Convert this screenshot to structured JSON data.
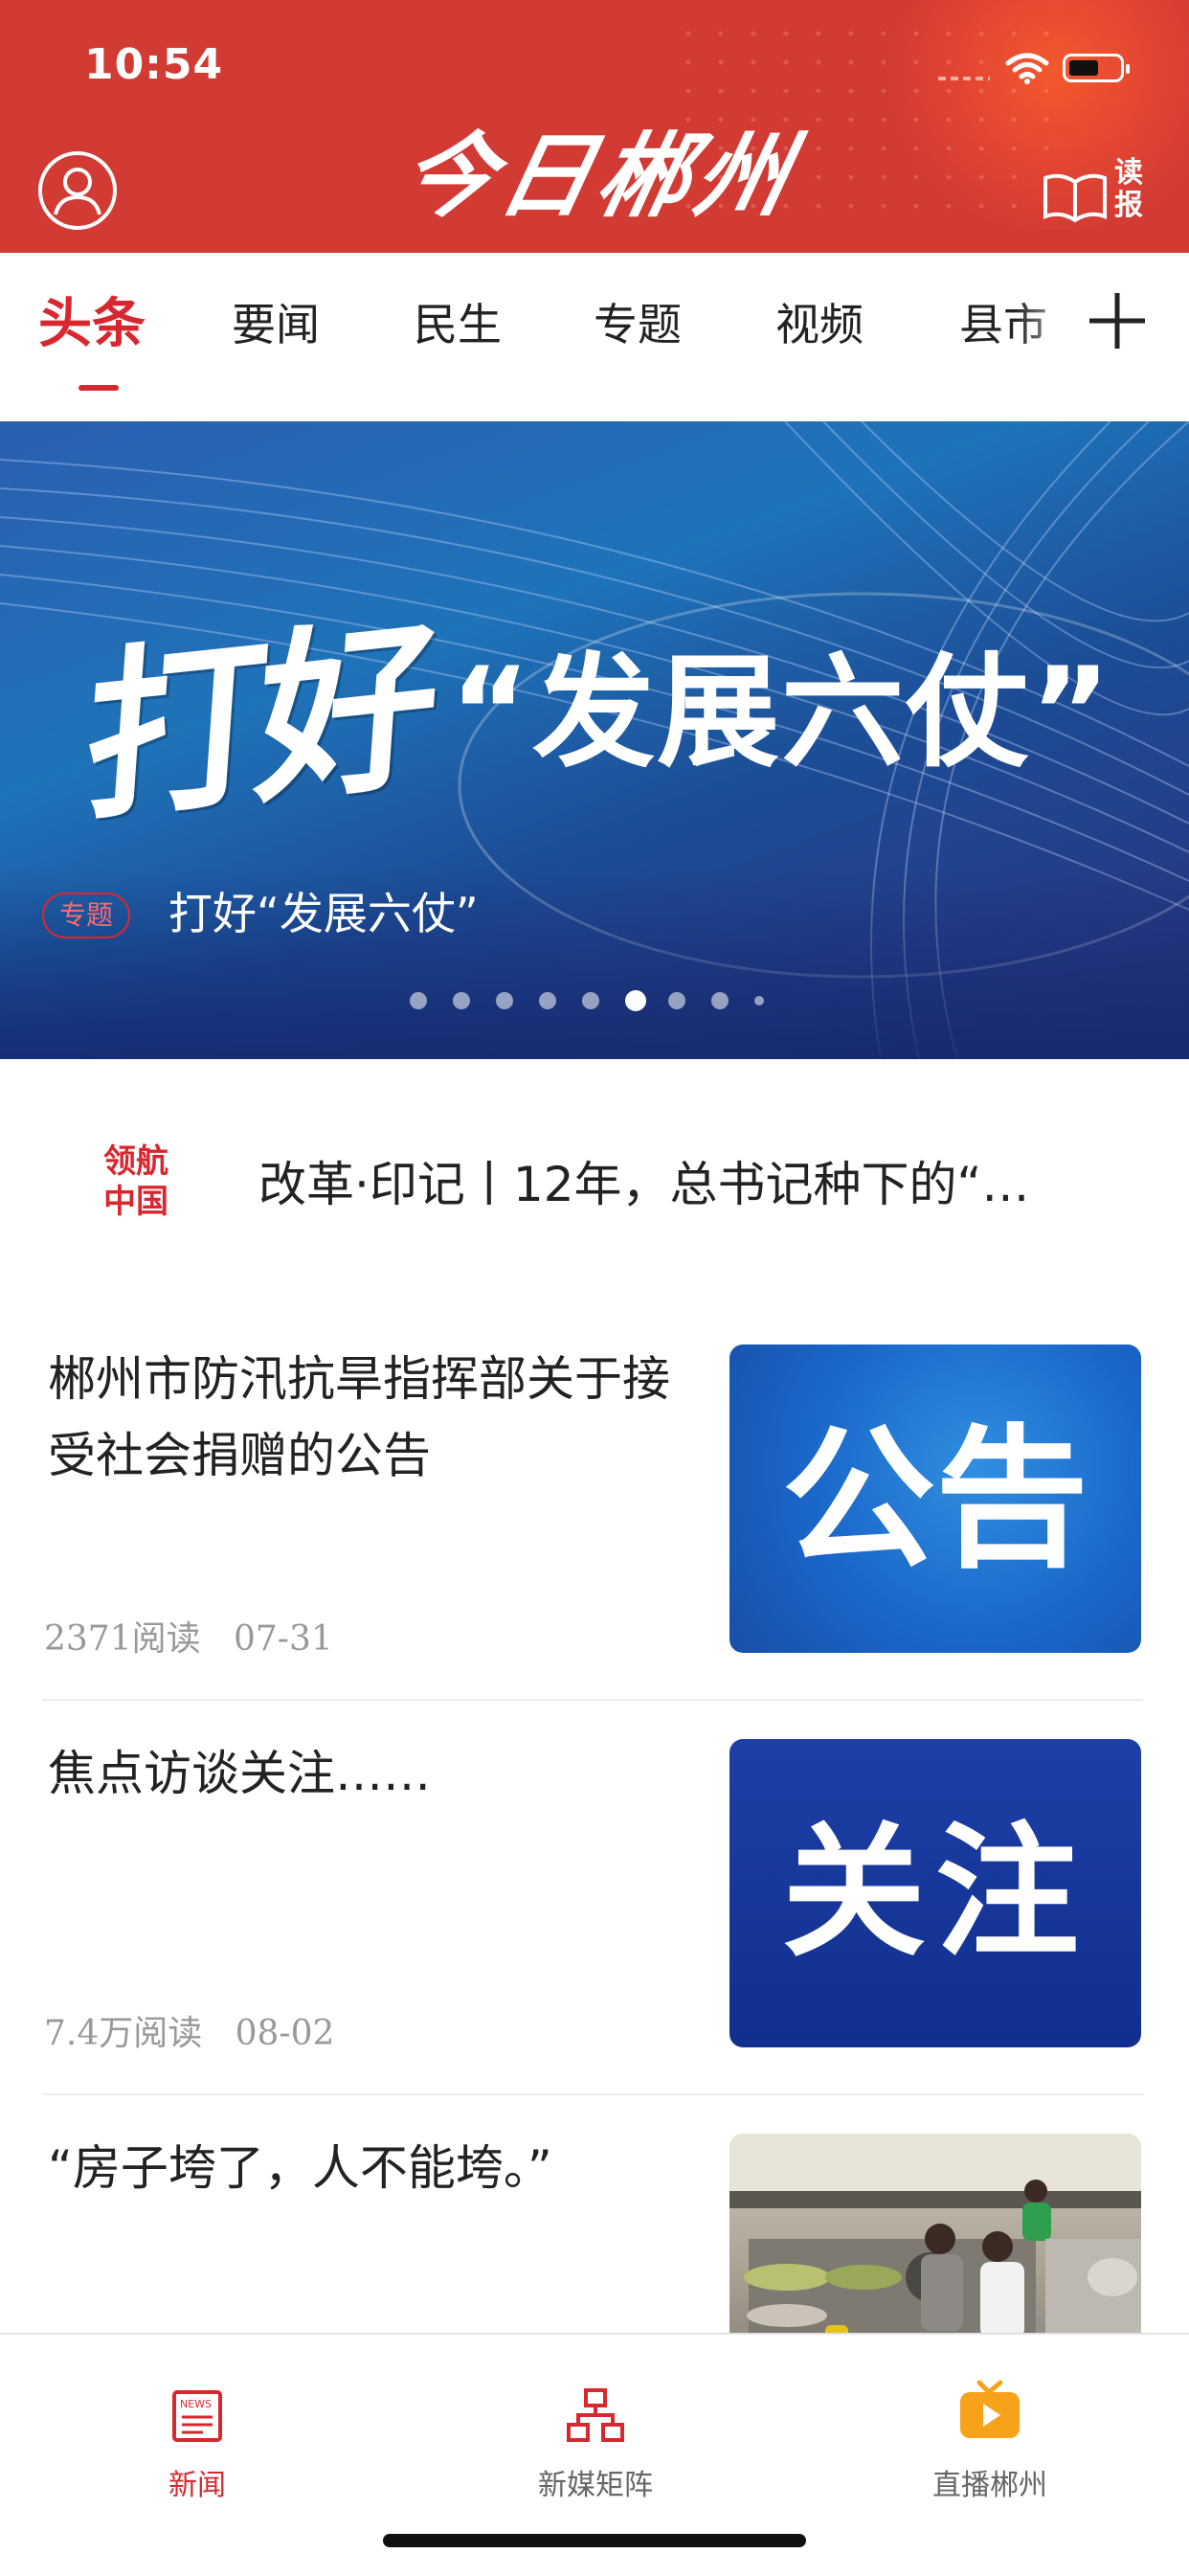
{
  "status_bar": {
    "time": "10:54"
  },
  "header": {
    "logo_text": "今日郴州",
    "read_paper_label": "读报"
  },
  "tabs": [
    {
      "label": "头条",
      "active": true
    },
    {
      "label": "要闻",
      "active": false
    },
    {
      "label": "民生",
      "active": false
    },
    {
      "label": "专题",
      "active": false
    },
    {
      "label": "视频",
      "active": false
    },
    {
      "label": "县市",
      "active": false
    }
  ],
  "banner": {
    "headline_brush": "打好",
    "headline_phrase": "“发展六仗”",
    "badge": "专题",
    "caption": "打好“发展六仗”",
    "dot_count": 9,
    "active_dot": 5
  },
  "ticker": {
    "logo": "领航中国",
    "text": "改革·印记丨12年，总书记种下的“…"
  },
  "articles": [
    {
      "title": "郴州市防汛抗旱指挥部关于接受社会捐赠的公告",
      "reads": "2371阅读",
      "date": "07-31",
      "thumb_text": "公告"
    },
    {
      "title": "焦点访谈关注……",
      "reads": "7.4万阅读",
      "date": "08-02",
      "thumb_text": "关注"
    },
    {
      "title": "“房子垮了，人不能垮。”",
      "reads": "",
      "date": "",
      "thumb_text": ""
    }
  ],
  "bottom_nav": [
    {
      "label": "新闻",
      "icon": "newspaper-icon",
      "active": true
    },
    {
      "label": "新媒矩阵",
      "icon": "network-icon",
      "active": false
    },
    {
      "label": "直播郴州",
      "icon": "tv-play-icon",
      "active": false
    }
  ],
  "colors": {
    "brand_red": "#d23a34",
    "accent_red": "#d8282f",
    "live_orange": "#f7a21b"
  }
}
